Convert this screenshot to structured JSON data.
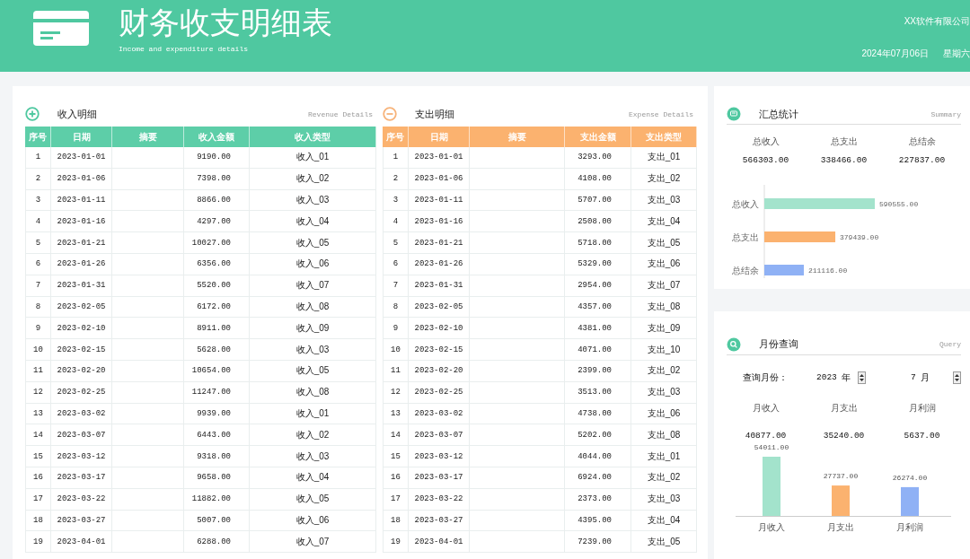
{
  "header": {
    "title": "财务收支明细表",
    "subtitle": "Income and expenditure details",
    "company": "XX软件有限公司",
    "date": "2024年07月06日",
    "weekday": "星期六"
  },
  "income": {
    "title": "收入明细",
    "subtitle": "Revenue Details",
    "columns": [
      "序号",
      "日期",
      "摘要",
      "收入金额",
      "收入类型"
    ],
    "rows": [
      {
        "no": "1",
        "date": "2023-01-01",
        "amount": "9190.00",
        "type": "收入_01"
      },
      {
        "no": "2",
        "date": "2023-01-06",
        "amount": "7398.00",
        "type": "收入_02"
      },
      {
        "no": "3",
        "date": "2023-01-11",
        "amount": "8866.00",
        "type": "收入_03"
      },
      {
        "no": "4",
        "date": "2023-01-16",
        "amount": "4297.00",
        "type": "收入_04"
      },
      {
        "no": "5",
        "date": "2023-01-21",
        "amount": "10027.00",
        "type": "收入_05"
      },
      {
        "no": "6",
        "date": "2023-01-26",
        "amount": "6356.00",
        "type": "收入_06"
      },
      {
        "no": "7",
        "date": "2023-01-31",
        "amount": "5520.00",
        "type": "收入_07"
      },
      {
        "no": "8",
        "date": "2023-02-05",
        "amount": "6172.00",
        "type": "收入_08"
      },
      {
        "no": "9",
        "date": "2023-02-10",
        "amount": "8911.00",
        "type": "收入_09"
      },
      {
        "no": "10",
        "date": "2023-02-15",
        "amount": "5628.00",
        "type": "收入_03"
      },
      {
        "no": "11",
        "date": "2023-02-20",
        "amount": "10654.00",
        "type": "收入_05"
      },
      {
        "no": "12",
        "date": "2023-02-25",
        "amount": "11247.00",
        "type": "收入_08"
      },
      {
        "no": "13",
        "date": "2023-03-02",
        "amount": "9939.00",
        "type": "收入_01"
      },
      {
        "no": "14",
        "date": "2023-03-07",
        "amount": "6443.00",
        "type": "收入_02"
      },
      {
        "no": "15",
        "date": "2023-03-12",
        "amount": "9318.00",
        "type": "收入_03"
      },
      {
        "no": "16",
        "date": "2023-03-17",
        "amount": "9658.00",
        "type": "收入_04"
      },
      {
        "no": "17",
        "date": "2023-03-22",
        "amount": "11882.00",
        "type": "收入_05"
      },
      {
        "no": "18",
        "date": "2023-03-27",
        "amount": "5007.00",
        "type": "收入_06"
      },
      {
        "no": "19",
        "date": "2023-04-01",
        "amount": "6288.00",
        "type": "收入_07"
      }
    ]
  },
  "expense": {
    "title": "支出明细",
    "subtitle": "Expense Details",
    "columns": [
      "序号",
      "日期",
      "摘要",
      "支出金额",
      "支出类型"
    ],
    "rows": [
      {
        "no": "1",
        "date": "2023-01-01",
        "amount": "3293.00",
        "type": "支出_01"
      },
      {
        "no": "2",
        "date": "2023-01-06",
        "amount": "4108.00",
        "type": "支出_02"
      },
      {
        "no": "3",
        "date": "2023-01-11",
        "amount": "5707.00",
        "type": "支出_03"
      },
      {
        "no": "4",
        "date": "2023-01-16",
        "amount": "2508.00",
        "type": "支出_04"
      },
      {
        "no": "5",
        "date": "2023-01-21",
        "amount": "5718.00",
        "type": "支出_05"
      },
      {
        "no": "6",
        "date": "2023-01-26",
        "amount": "5329.00",
        "type": "支出_06"
      },
      {
        "no": "7",
        "date": "2023-01-31",
        "amount": "2954.00",
        "type": "支出_07"
      },
      {
        "no": "8",
        "date": "2023-02-05",
        "amount": "4357.00",
        "type": "支出_08"
      },
      {
        "no": "9",
        "date": "2023-02-10",
        "amount": "4381.00",
        "type": "支出_09"
      },
      {
        "no": "10",
        "date": "2023-02-15",
        "amount": "4071.00",
        "type": "支出_10"
      },
      {
        "no": "11",
        "date": "2023-02-20",
        "amount": "2399.00",
        "type": "支出_02"
      },
      {
        "no": "12",
        "date": "2023-02-25",
        "amount": "3513.00",
        "type": "支出_03"
      },
      {
        "no": "13",
        "date": "2023-03-02",
        "amount": "4738.00",
        "type": "支出_06"
      },
      {
        "no": "14",
        "date": "2023-03-07",
        "amount": "5202.00",
        "type": "支出_08"
      },
      {
        "no": "15",
        "date": "2023-03-12",
        "amount": "4044.00",
        "type": "支出_01"
      },
      {
        "no": "16",
        "date": "2023-03-17",
        "amount": "6924.00",
        "type": "支出_02"
      },
      {
        "no": "17",
        "date": "2023-03-22",
        "amount": "2373.00",
        "type": "支出_03"
      },
      {
        "no": "18",
        "date": "2023-03-27",
        "amount": "4395.00",
        "type": "支出_04"
      },
      {
        "no": "19",
        "date": "2023-04-01",
        "amount": "7239.00",
        "type": "支出_05"
      }
    ]
  },
  "summary": {
    "title": "汇总统计",
    "subtitle": "Summary",
    "stats": [
      {
        "label": "总收入",
        "value": "566303.00"
      },
      {
        "label": "总支出",
        "value": "338466.00"
      },
      {
        "label": "总结余",
        "value": "227837.00"
      }
    ],
    "chart_data": {
      "type": "bar",
      "orientation": "horizontal",
      "categories": [
        "总收入",
        "总支出",
        "总结余"
      ],
      "values": [
        590555,
        379439,
        211116
      ],
      "value_labels": [
        "590555.00",
        "379439.00",
        "211116.00"
      ]
    }
  },
  "query": {
    "title": "月份查询",
    "subtitle": "Query",
    "label": "查询月份：",
    "year": "2023",
    "year_unit": "年",
    "month": "7",
    "month_unit": "月",
    "stats": [
      {
        "label": "月收入",
        "value": "40877.00"
      },
      {
        "label": "月支出",
        "value": "35240.00"
      },
      {
        "label": "月利润",
        "value": "5637.00"
      }
    ],
    "chart_data": {
      "type": "bar",
      "categories": [
        "月收入",
        "月支出",
        "月利润"
      ],
      "values": [
        54011,
        27737,
        26274
      ],
      "value_labels": [
        "54011.00",
        "27737.00",
        "26274.00"
      ]
    }
  }
}
